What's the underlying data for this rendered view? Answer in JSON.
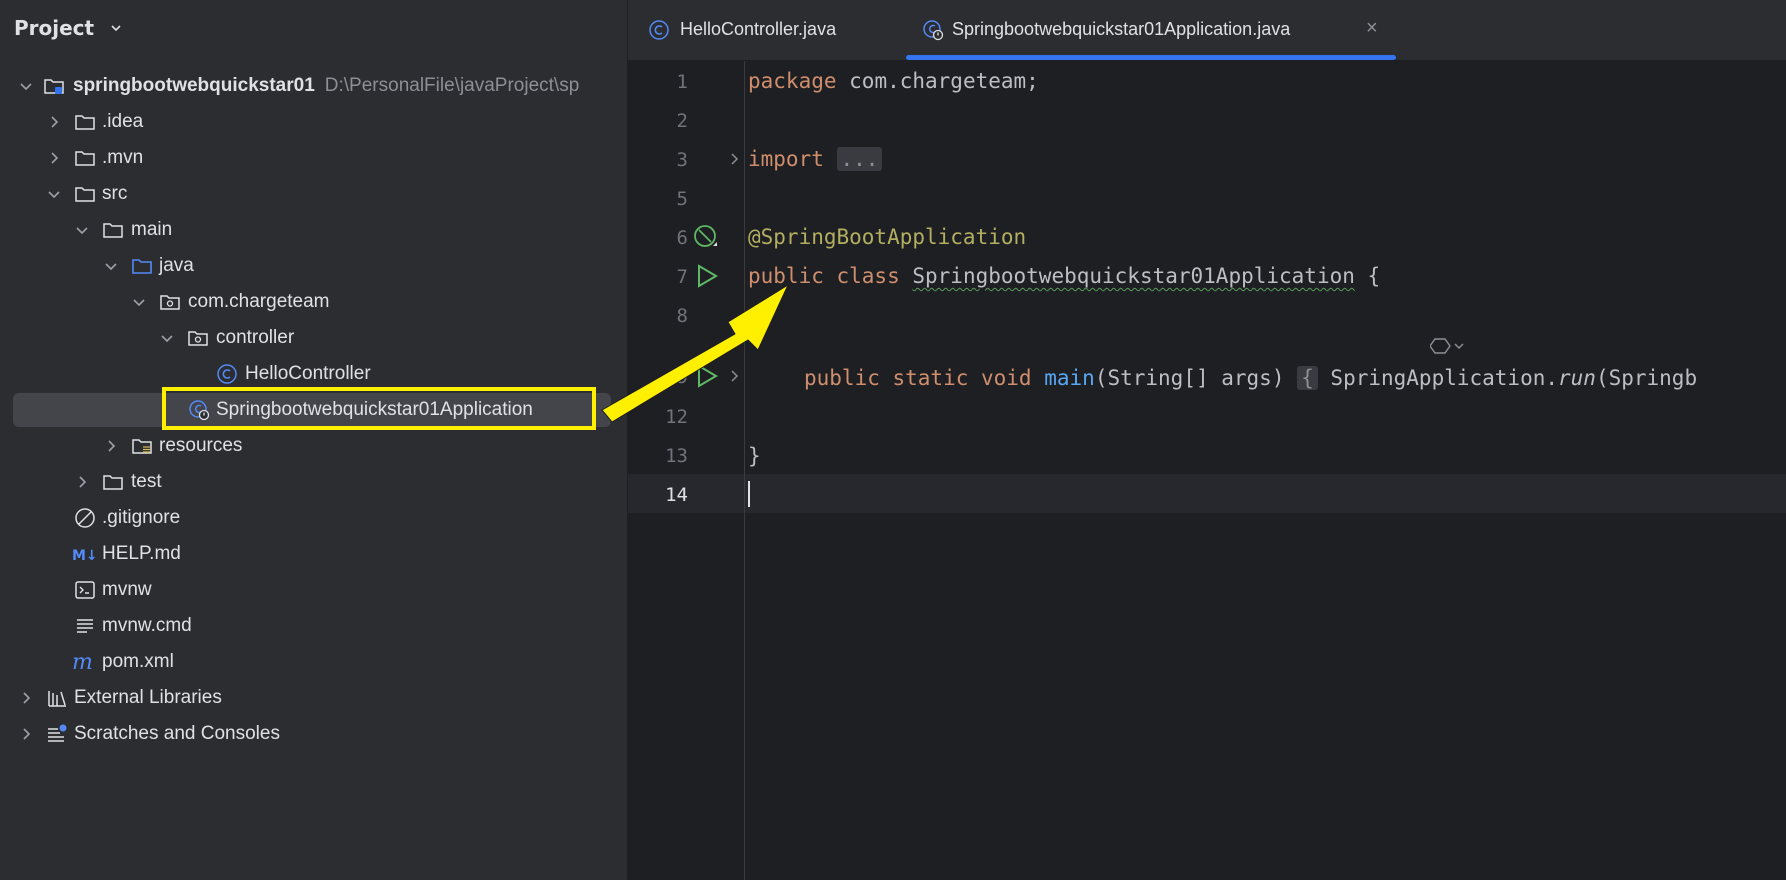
{
  "project_panel": {
    "title": "Project",
    "tree": [
      {
        "label": "springbootwebquickstar01",
        "path": "D:\\PersonalFile\\javaProject\\sp",
        "icon": "module-folder-icon",
        "twisty": "expanded"
      },
      {
        "label": ".idea",
        "icon": "folder-icon",
        "twisty": "collapsed"
      },
      {
        "label": ".mvn",
        "icon": "folder-icon",
        "twisty": "collapsed"
      },
      {
        "label": "src",
        "icon": "folder-icon",
        "twisty": "expanded"
      },
      {
        "label": "main",
        "icon": "folder-icon",
        "twisty": "expanded"
      },
      {
        "label": "java",
        "icon": "source-folder-icon",
        "twisty": "expanded"
      },
      {
        "label": "com.chargeteam",
        "icon": "package-icon",
        "twisty": "expanded"
      },
      {
        "label": "controller",
        "icon": "package-icon",
        "twisty": "expanded"
      },
      {
        "label": "HelloController",
        "icon": "class-icon",
        "twisty": "none"
      },
      {
        "label": "Springbootwebquickstar01Application",
        "icon": "spring-class-icon",
        "twisty": "none",
        "selected": true
      },
      {
        "label": "resources",
        "icon": "resources-folder-icon",
        "twisty": "collapsed"
      },
      {
        "label": "test",
        "icon": "folder-icon",
        "twisty": "collapsed"
      },
      {
        "label": ".gitignore",
        "icon": "ignore-file-icon",
        "twisty": "none"
      },
      {
        "label": "HELP.md",
        "icon": "markdown-icon",
        "twisty": "none"
      },
      {
        "label": "mvnw",
        "icon": "terminal-file-icon",
        "twisty": "none"
      },
      {
        "label": "mvnw.cmd",
        "icon": "text-file-icon",
        "twisty": "none"
      },
      {
        "label": "pom.xml",
        "icon": "maven-icon",
        "twisty": "none"
      },
      {
        "label": "External Libraries",
        "icon": "library-icon",
        "twisty": "collapsed"
      },
      {
        "label": "Scratches and Consoles",
        "icon": "scratches-icon",
        "twisty": "collapsed"
      }
    ]
  },
  "tabs": [
    {
      "label": "HelloController.java",
      "icon": "class-icon",
      "active": false
    },
    {
      "label": "Springbootwebquickstar01Application.java",
      "icon": "spring-class-icon",
      "active": true,
      "close": "×"
    }
  ],
  "editor": {
    "line_numbers": [
      "1",
      "2",
      "3",
      "5",
      "6",
      "7",
      "8",
      "9",
      "12",
      "13",
      "14"
    ],
    "code": {
      "l1_kw": "package",
      "l1_rest": " com.chargeteam;",
      "l3_kw": "import",
      "l3_fold": "...",
      "l6_ann": "@SpringBootApplication",
      "l7_kw": "public class",
      "l7_cls": "Springbootwebquickstar01Application",
      "l7_rest": " {",
      "l9_kw": "public static void",
      "l9_fn": "main",
      "l9_args": "(String[] args)",
      "l9_brace": "{",
      "l9_call": " SpringApplication.",
      "l9_run": "run",
      "l9_tail": "(Springb",
      "l13": "}"
    }
  },
  "colors": {
    "highlight": "#fff000",
    "accent": "#3574f0"
  }
}
